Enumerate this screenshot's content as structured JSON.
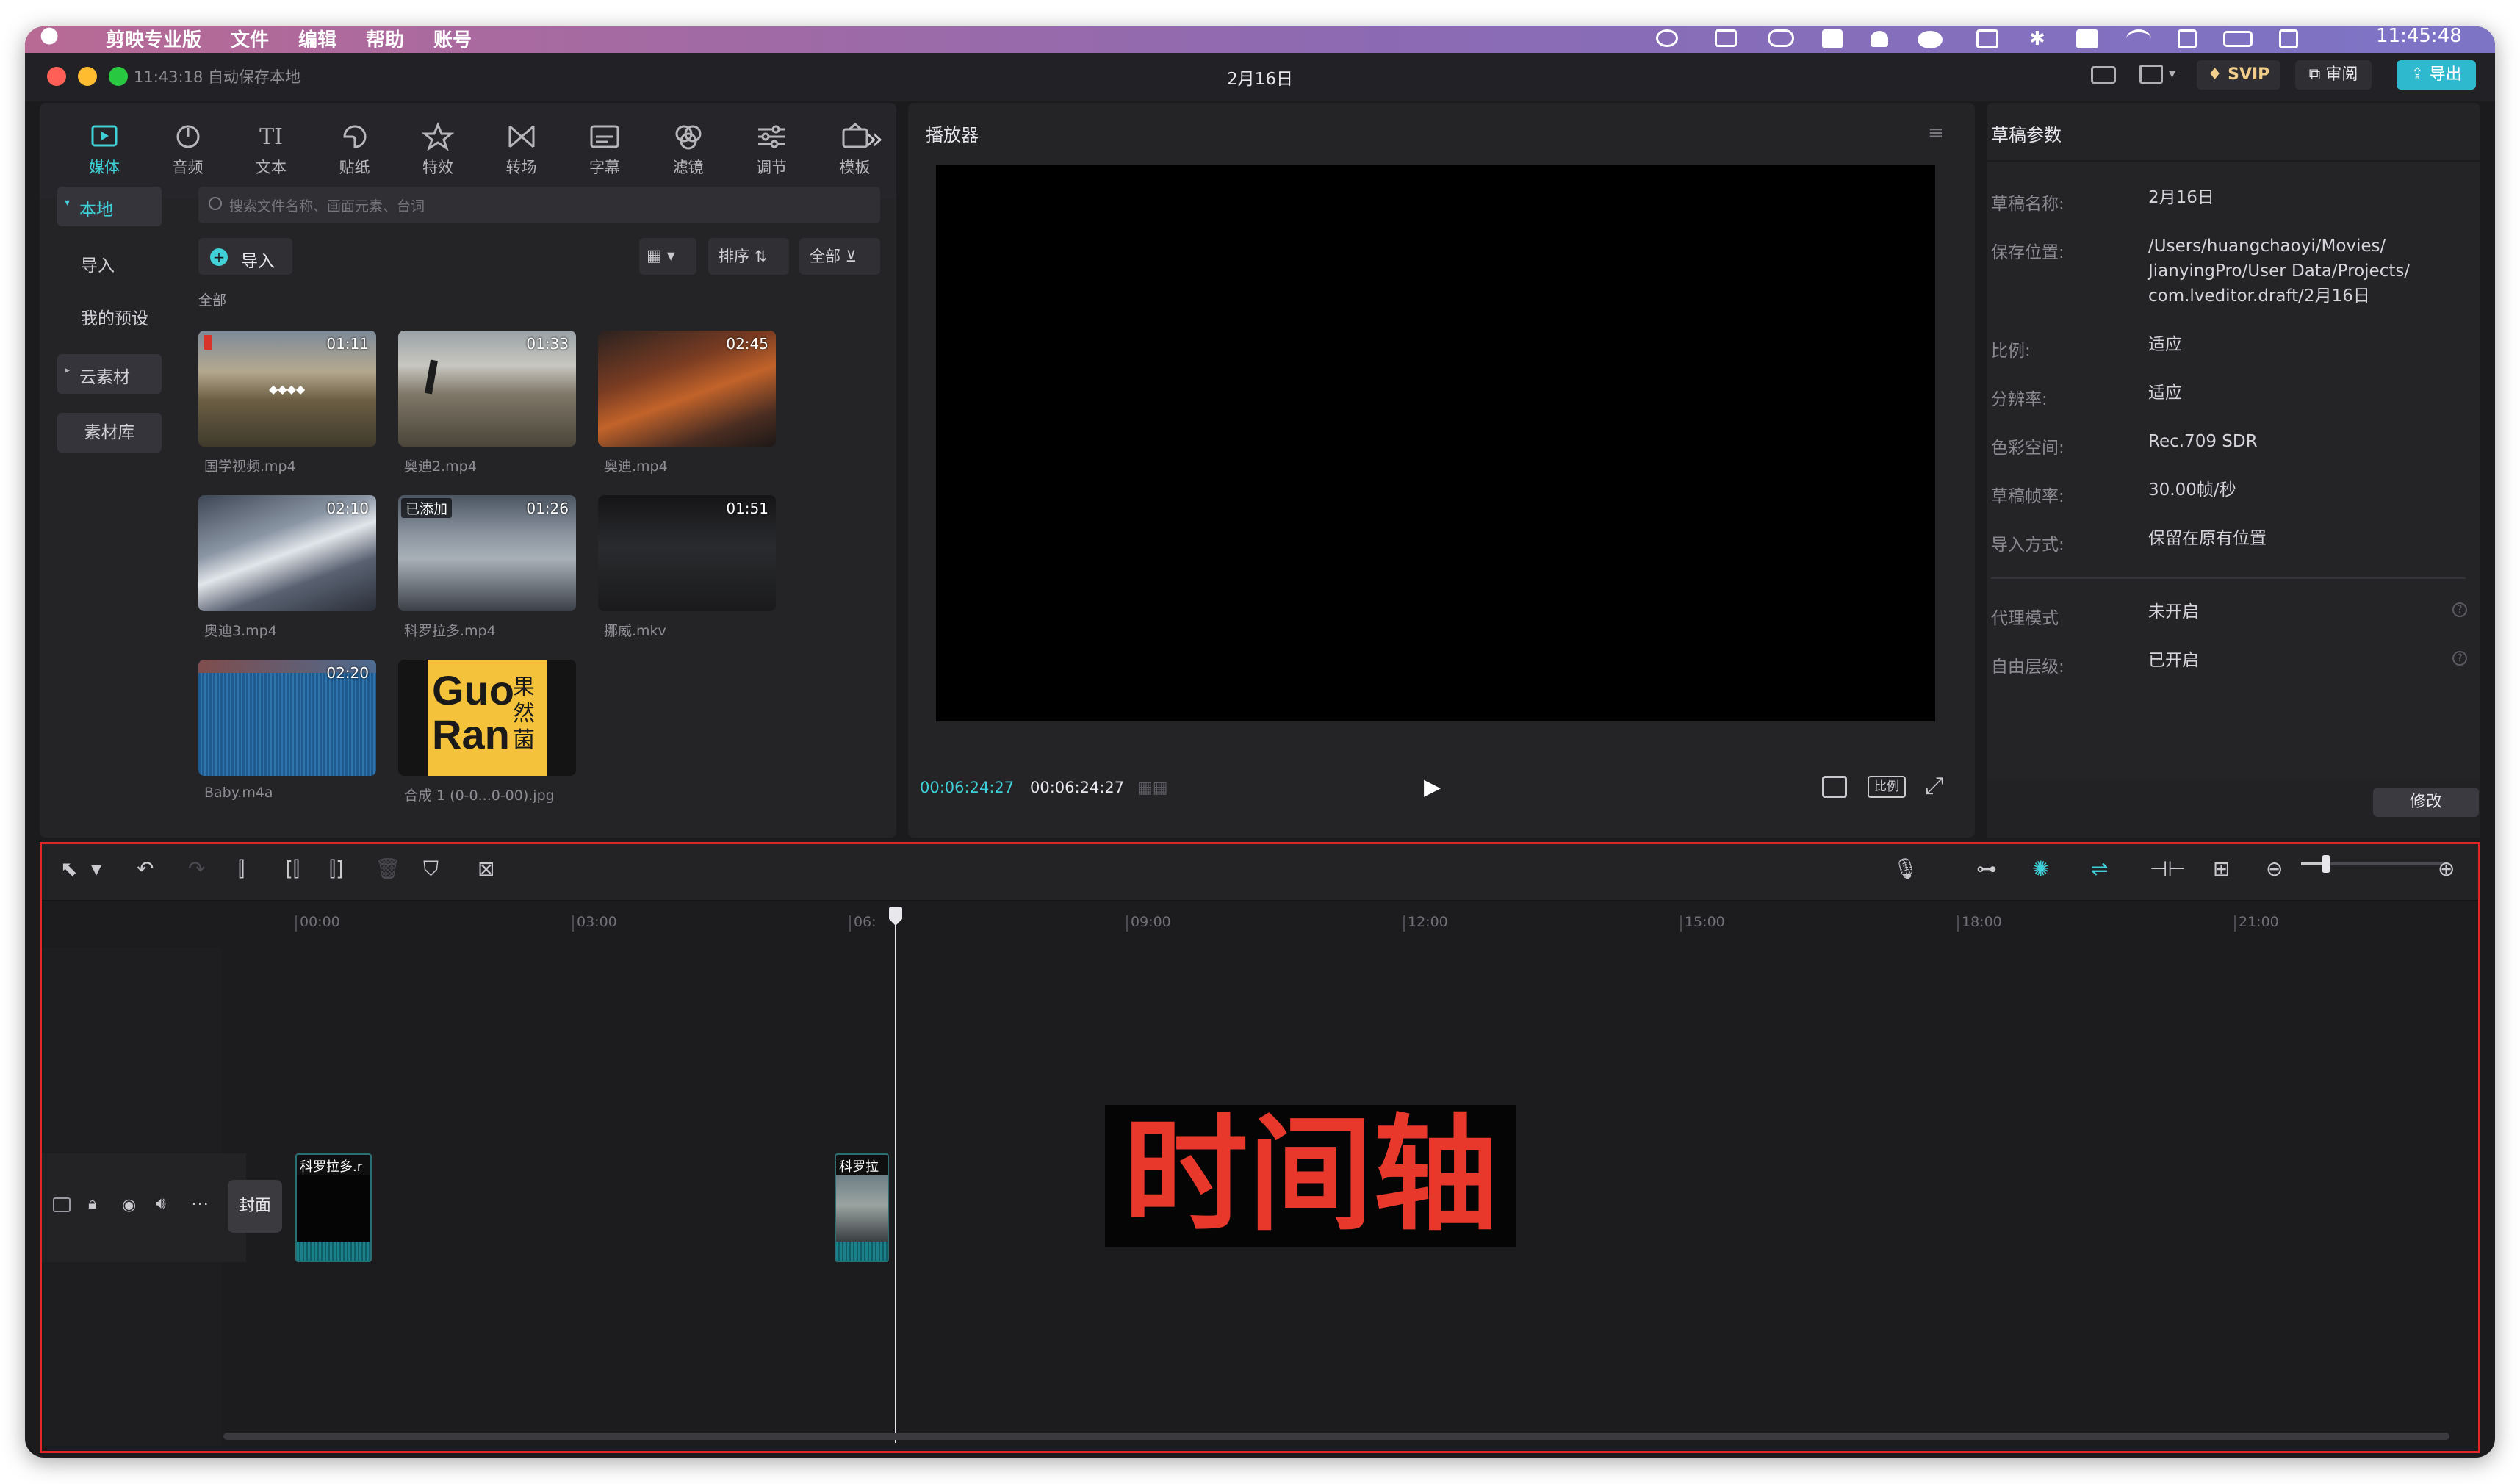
{
  "menubar": {
    "items": [
      "剪映专业版",
      "文件",
      "编辑",
      "帮助",
      "账号"
    ],
    "clock": "11:45:48"
  },
  "titlebar": {
    "autosave": "11:43:18 自动保存本地",
    "project_title": "2月16日",
    "svip_label": "SVIP",
    "review_label": "审阅",
    "export_label": "导出"
  },
  "media_toolbar": {
    "tabs": [
      {
        "label": "媒体",
        "icon": "media-icon",
        "active": true
      },
      {
        "label": "音频",
        "icon": "audio-icon"
      },
      {
        "label": "文本",
        "icon": "text-icon"
      },
      {
        "label": "贴纸",
        "icon": "sticker-icon"
      },
      {
        "label": "特效",
        "icon": "effects-icon"
      },
      {
        "label": "转场",
        "icon": "transition-icon"
      },
      {
        "label": "字幕",
        "icon": "subtitle-icon"
      },
      {
        "label": "滤镜",
        "icon": "filter-icon"
      },
      {
        "label": "调节",
        "icon": "adjust-icon"
      },
      {
        "label": "模板",
        "icon": "template-icon"
      }
    ]
  },
  "media_sidebar": {
    "items": [
      "本地",
      "导入",
      "我的预设",
      "云素材",
      "素材库"
    ]
  },
  "media_browser": {
    "search_placeholder": "搜索文件名称、画面元素、台词",
    "import_label": "导入",
    "sort_label": "排序",
    "filter_label": "全部",
    "section_label": "全部",
    "items": [
      {
        "name": "国学视频.mp4",
        "duration": "01:11"
      },
      {
        "name": "奥迪2.mp4",
        "duration": "01:33"
      },
      {
        "name": "奥迪.mp4",
        "duration": "02:45"
      },
      {
        "name": "奥迪3.mp4",
        "duration": "02:10"
      },
      {
        "name": "科罗拉多.mp4",
        "duration": "01:26",
        "badge": "已添加"
      },
      {
        "name": "挪威.mkv",
        "duration": "01:51"
      },
      {
        "name": "Baby.m4a",
        "duration": "02:20"
      },
      {
        "name": "合成 1 (0-0...0-00).jpg",
        "duration": ""
      }
    ],
    "logo_text": {
      "line1": "Guo",
      "line2": "Ran",
      "cn": "果然菌"
    }
  },
  "player": {
    "title": "播放器",
    "current_time": "00:06:24:27",
    "total_time": "00:06:24:27",
    "ratio_label": "比例"
  },
  "draft_params": {
    "title": "草稿参数",
    "rows": [
      {
        "label": "草稿名称:",
        "value": "2月16日"
      },
      {
        "label": "保存位置:",
        "value": "/Users/huangchaoyi/Movies/\nJianyingPro/User Data/Projects/\ncom.lveditor.draft/2月16日"
      },
      {
        "label": "比例:",
        "value": "适应"
      },
      {
        "label": "分辨率:",
        "value": "适应"
      },
      {
        "label": "色彩空间:",
        "value": "Rec.709 SDR"
      },
      {
        "label": "草稿帧率:",
        "value": "30.00帧/秒"
      },
      {
        "label": "导入方式:",
        "value": "保留在原有位置"
      },
      {
        "label": "代理模式",
        "value": "未开启"
      },
      {
        "label": "自由层级:",
        "value": "已开启"
      }
    ],
    "modify_label": "修改"
  },
  "timeline": {
    "ticks": [
      "00:00",
      "03:00",
      "06:",
      "09:00",
      "12:00",
      "15:00",
      "18:00",
      "21:00"
    ],
    "cover_label": "封面",
    "clip1_label": "科罗拉多.r",
    "clip2_label": "科罗拉",
    "annotation": "时间轴"
  },
  "colors": {
    "accent": "#3fd0d8",
    "highlight_border": "#e0262a",
    "annotation_text": "#e8382b",
    "svip_gold": "#f1cf8a",
    "export_btn": "#2fb9cf"
  }
}
